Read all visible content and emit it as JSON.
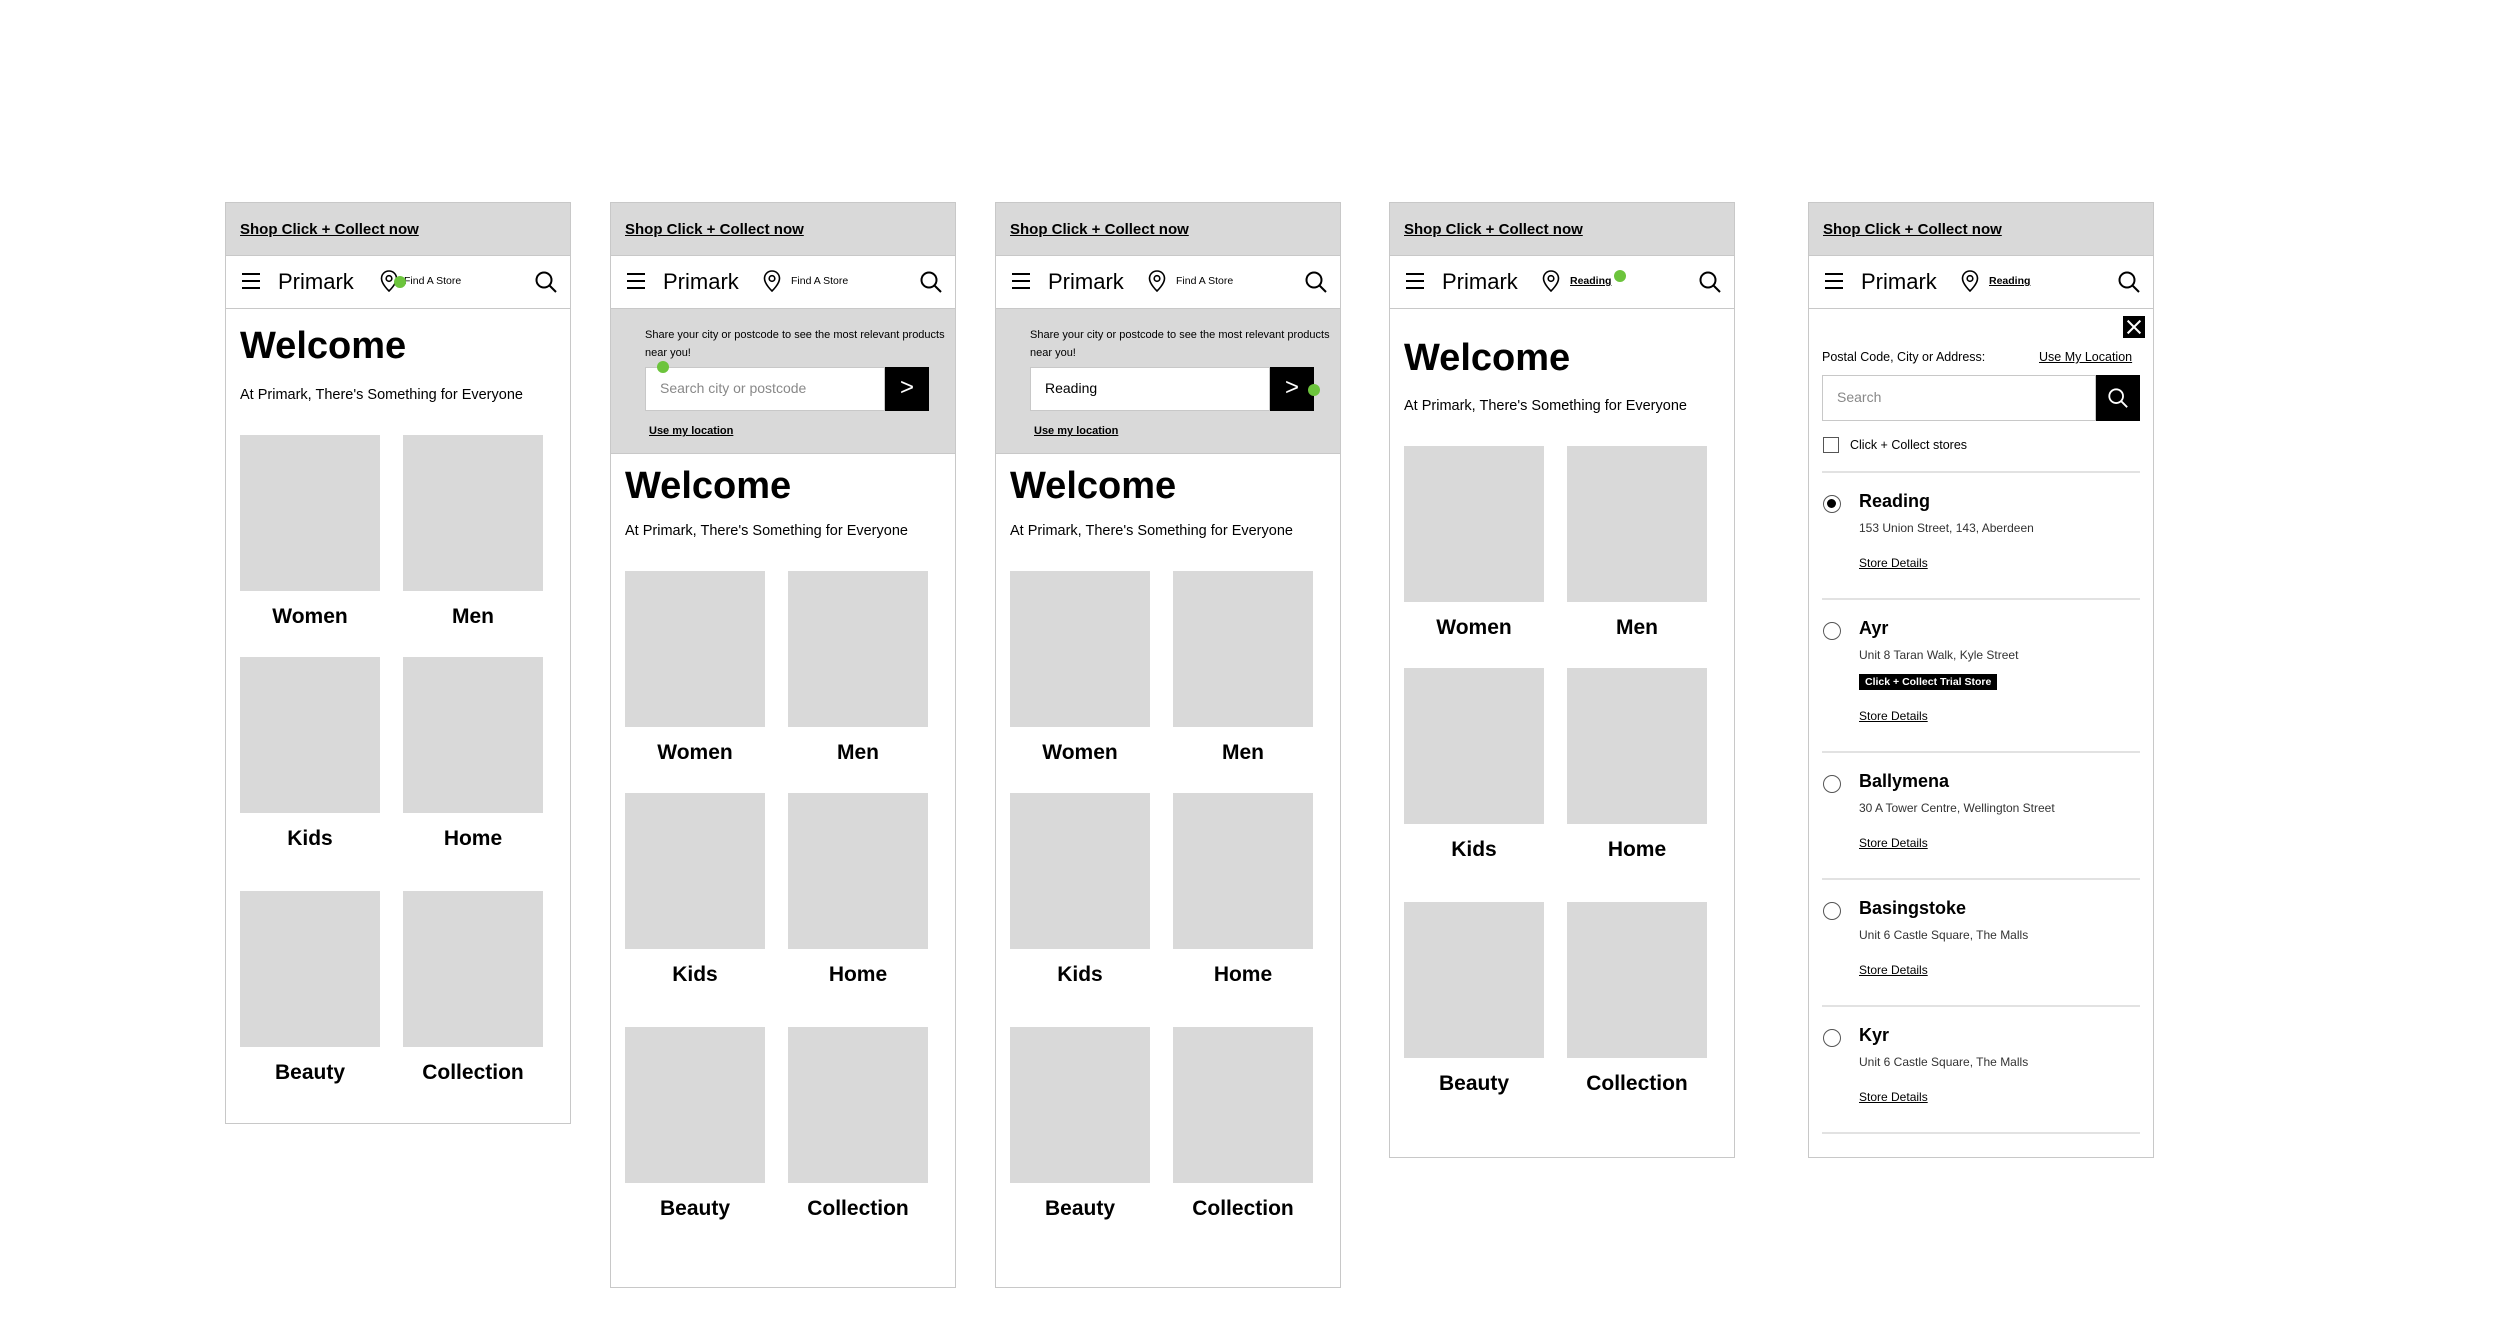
{
  "promo_text": "Shop Click + Collect now",
  "brand": "Primark",
  "find_store_label": "Find A Store",
  "selected_store_label": "Reading",
  "welcome_title": "Welcome",
  "welcome_subtitle": "At Primark, There's Something for Everyone",
  "categories": [
    "Women",
    "Men",
    "Kids",
    "Home",
    "Beauty",
    "Collection"
  ],
  "location_prompt": {
    "share_text": "Share your city or postcode to see the most relevant products near you!",
    "placeholder": "Search city or postcode",
    "filled_value": "Reading",
    "go_symbol": ">",
    "use_location": "Use my location"
  },
  "store_finder": {
    "field_label": "Postal Code, City or Address:",
    "use_my_location": "Use My Location",
    "search_placeholder": "Search",
    "filter_label": "Click + Collect stores",
    "store_details_label": "Store Details",
    "stores": [
      {
        "name": "Reading",
        "address": "153 Union Street, 143, Aberdeen",
        "selected": true,
        "badge": ""
      },
      {
        "name": "Ayr",
        "address": "Unit 8 Taran Walk, Kyle Street",
        "selected": false,
        "badge": "Click + Collect Trial Store"
      },
      {
        "name": "Ballymena",
        "address": "30 A Tower Centre, Wellington Street",
        "selected": false,
        "badge": ""
      },
      {
        "name": "Basingstoke",
        "address": "Unit 6 Castle Square, The Malls",
        "selected": false,
        "badge": ""
      },
      {
        "name": "Kyr",
        "address": "Unit 6 Castle Square, The Malls",
        "selected": false,
        "badge": ""
      }
    ]
  },
  "colors": {
    "placeholder_grey": "#d9d9d9",
    "border_grey": "#c8c8c8",
    "interaction_dot": "#6cc43c",
    "primary": "#000000"
  }
}
